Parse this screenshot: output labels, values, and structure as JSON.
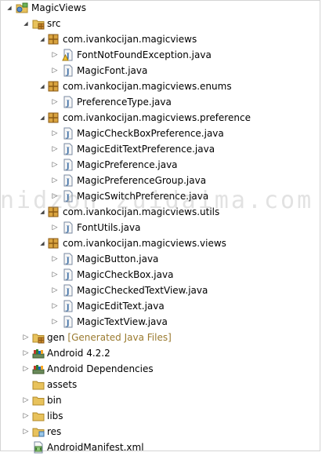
{
  "tree": [
    {
      "label": "MagicViews",
      "depth": 0,
      "expanded": true,
      "icon": "project-icon"
    },
    {
      "label": "src",
      "depth": 1,
      "expanded": true,
      "icon": "source-folder-icon"
    },
    {
      "label": "com.ivankocijan.magicviews",
      "depth": 2,
      "expanded": true,
      "icon": "package-icon"
    },
    {
      "label": "FontNotFoundException.java",
      "depth": 3,
      "expanded": false,
      "icon": "java-file-warning-icon"
    },
    {
      "label": "MagicFont.java",
      "depth": 3,
      "expanded": false,
      "icon": "java-file-icon"
    },
    {
      "label": "com.ivankocijan.magicviews.enums",
      "depth": 2,
      "expanded": true,
      "icon": "package-icon"
    },
    {
      "label": "PreferenceType.java",
      "depth": 3,
      "expanded": false,
      "icon": "java-file-icon"
    },
    {
      "label": "com.ivankocijan.magicviews.preference",
      "depth": 2,
      "expanded": true,
      "icon": "package-icon"
    },
    {
      "label": "MagicCheckBoxPreference.java",
      "depth": 3,
      "expanded": false,
      "icon": "java-file-icon"
    },
    {
      "label": "MagicEditTextPreference.java",
      "depth": 3,
      "expanded": false,
      "icon": "java-file-icon"
    },
    {
      "label": "MagicPreference.java",
      "depth": 3,
      "expanded": false,
      "icon": "java-file-icon"
    },
    {
      "label": "MagicPreferenceGroup.java",
      "depth": 3,
      "expanded": false,
      "icon": "java-file-icon"
    },
    {
      "label": "MagicSwitchPreference.java",
      "depth": 3,
      "expanded": false,
      "icon": "java-file-icon"
    },
    {
      "label": "com.ivankocijan.magicviews.utils",
      "depth": 2,
      "expanded": true,
      "icon": "package-icon"
    },
    {
      "label": "FontUtils.java",
      "depth": 3,
      "expanded": false,
      "icon": "java-file-icon"
    },
    {
      "label": "com.ivankocijan.magicviews.views",
      "depth": 2,
      "expanded": true,
      "icon": "package-icon"
    },
    {
      "label": "MagicButton.java",
      "depth": 3,
      "expanded": false,
      "icon": "java-file-icon"
    },
    {
      "label": "MagicCheckBox.java",
      "depth": 3,
      "expanded": false,
      "icon": "java-file-icon"
    },
    {
      "label": "MagicCheckedTextView.java",
      "depth": 3,
      "expanded": false,
      "icon": "java-file-icon"
    },
    {
      "label": "MagicEditText.java",
      "depth": 3,
      "expanded": false,
      "icon": "java-file-icon"
    },
    {
      "label": "MagicTextView.java",
      "depth": 3,
      "expanded": false,
      "icon": "java-file-icon"
    },
    {
      "label": "gen",
      "decoration": "[Generated Java Files]",
      "depth": 1,
      "expanded": false,
      "icon": "generated-folder-icon"
    },
    {
      "label": "Android 4.2.2",
      "depth": 1,
      "expanded": false,
      "icon": "library-icon"
    },
    {
      "label": "Android Dependencies",
      "depth": 1,
      "expanded": false,
      "icon": "library-icon"
    },
    {
      "label": "assets",
      "depth": 1,
      "icon": "folder-icon"
    },
    {
      "label": "bin",
      "depth": 1,
      "expanded": false,
      "icon": "folder-icon"
    },
    {
      "label": "libs",
      "depth": 1,
      "expanded": false,
      "icon": "folder-icon"
    },
    {
      "label": "res",
      "depth": 1,
      "expanded": false,
      "icon": "resource-folder-icon"
    },
    {
      "label": "AndroidManifest.xml",
      "depth": 1,
      "icon": "xml-file-icon"
    }
  ],
  "watermark": "nidzon zuidaima.com",
  "colors": {
    "decoration": "#9a7a2f",
    "folder": "#e8c25c",
    "package": "#c8852a",
    "java": "#3b6ea5"
  }
}
